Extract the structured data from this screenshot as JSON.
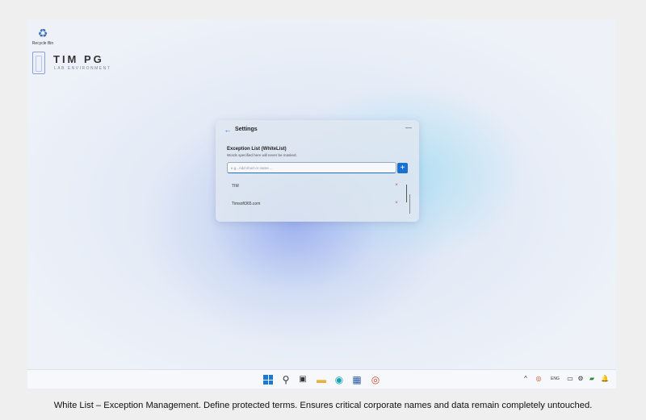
{
  "desktop": {
    "recycle_bin_label": "Recycle Bin",
    "logo_title": "TIM PG",
    "logo_subtitle": "LAB ENVIRONMENT"
  },
  "settings_window": {
    "title": "Settings",
    "section_title": "Exception List (WhiteList)",
    "section_description": "Words specified here will never be masked.",
    "input_placeholder": "e.g., Add short or name ...",
    "input_value": "",
    "add_button_label": "+",
    "remove_label": "×",
    "items": [
      {
        "label": "TIM"
      },
      {
        "label": "Timsoft365.com"
      }
    ]
  },
  "taskbar": {
    "apps": [
      {
        "name": "start",
        "glyph": ""
      },
      {
        "name": "search",
        "glyph": "⚲"
      },
      {
        "name": "task-view",
        "glyph": "▣"
      },
      {
        "name": "file-explorer",
        "glyph": "▬"
      },
      {
        "name": "edge",
        "glyph": "◉"
      },
      {
        "name": "store",
        "glyph": "▦"
      },
      {
        "name": "app",
        "glyph": "◎"
      }
    ],
    "tray": {
      "chevron": "^",
      "language": "ENG",
      "bell": "🔔"
    }
  },
  "caption": "White List – Exception Management. Define protected terms. Ensures critical corporate names and data remain completely untouched.",
  "colors": {
    "accent": "#1a6fd1",
    "remove": "#d24a4a"
  }
}
